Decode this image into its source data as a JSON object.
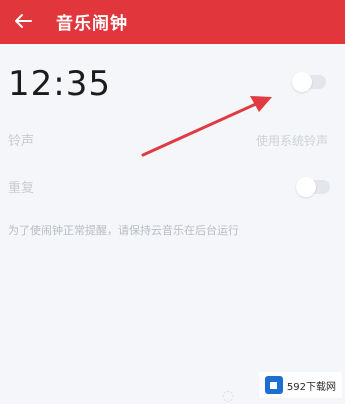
{
  "header": {
    "title": "音乐闹钟",
    "back_icon": "arrow-left-icon",
    "background": "#e0363c"
  },
  "alarm": {
    "time": "12:35",
    "enabled": false
  },
  "settings": {
    "ringtone_label": "铃声",
    "ringtone_value": "使用系统铃声",
    "repeat_label": "重复",
    "repeat_enabled": false
  },
  "hint": "为了使闹钟正常提醒，请保持云音乐在后台运行",
  "annotation": {
    "arrow_color": "#e03a43"
  },
  "watermark": {
    "text": "592下载网"
  }
}
